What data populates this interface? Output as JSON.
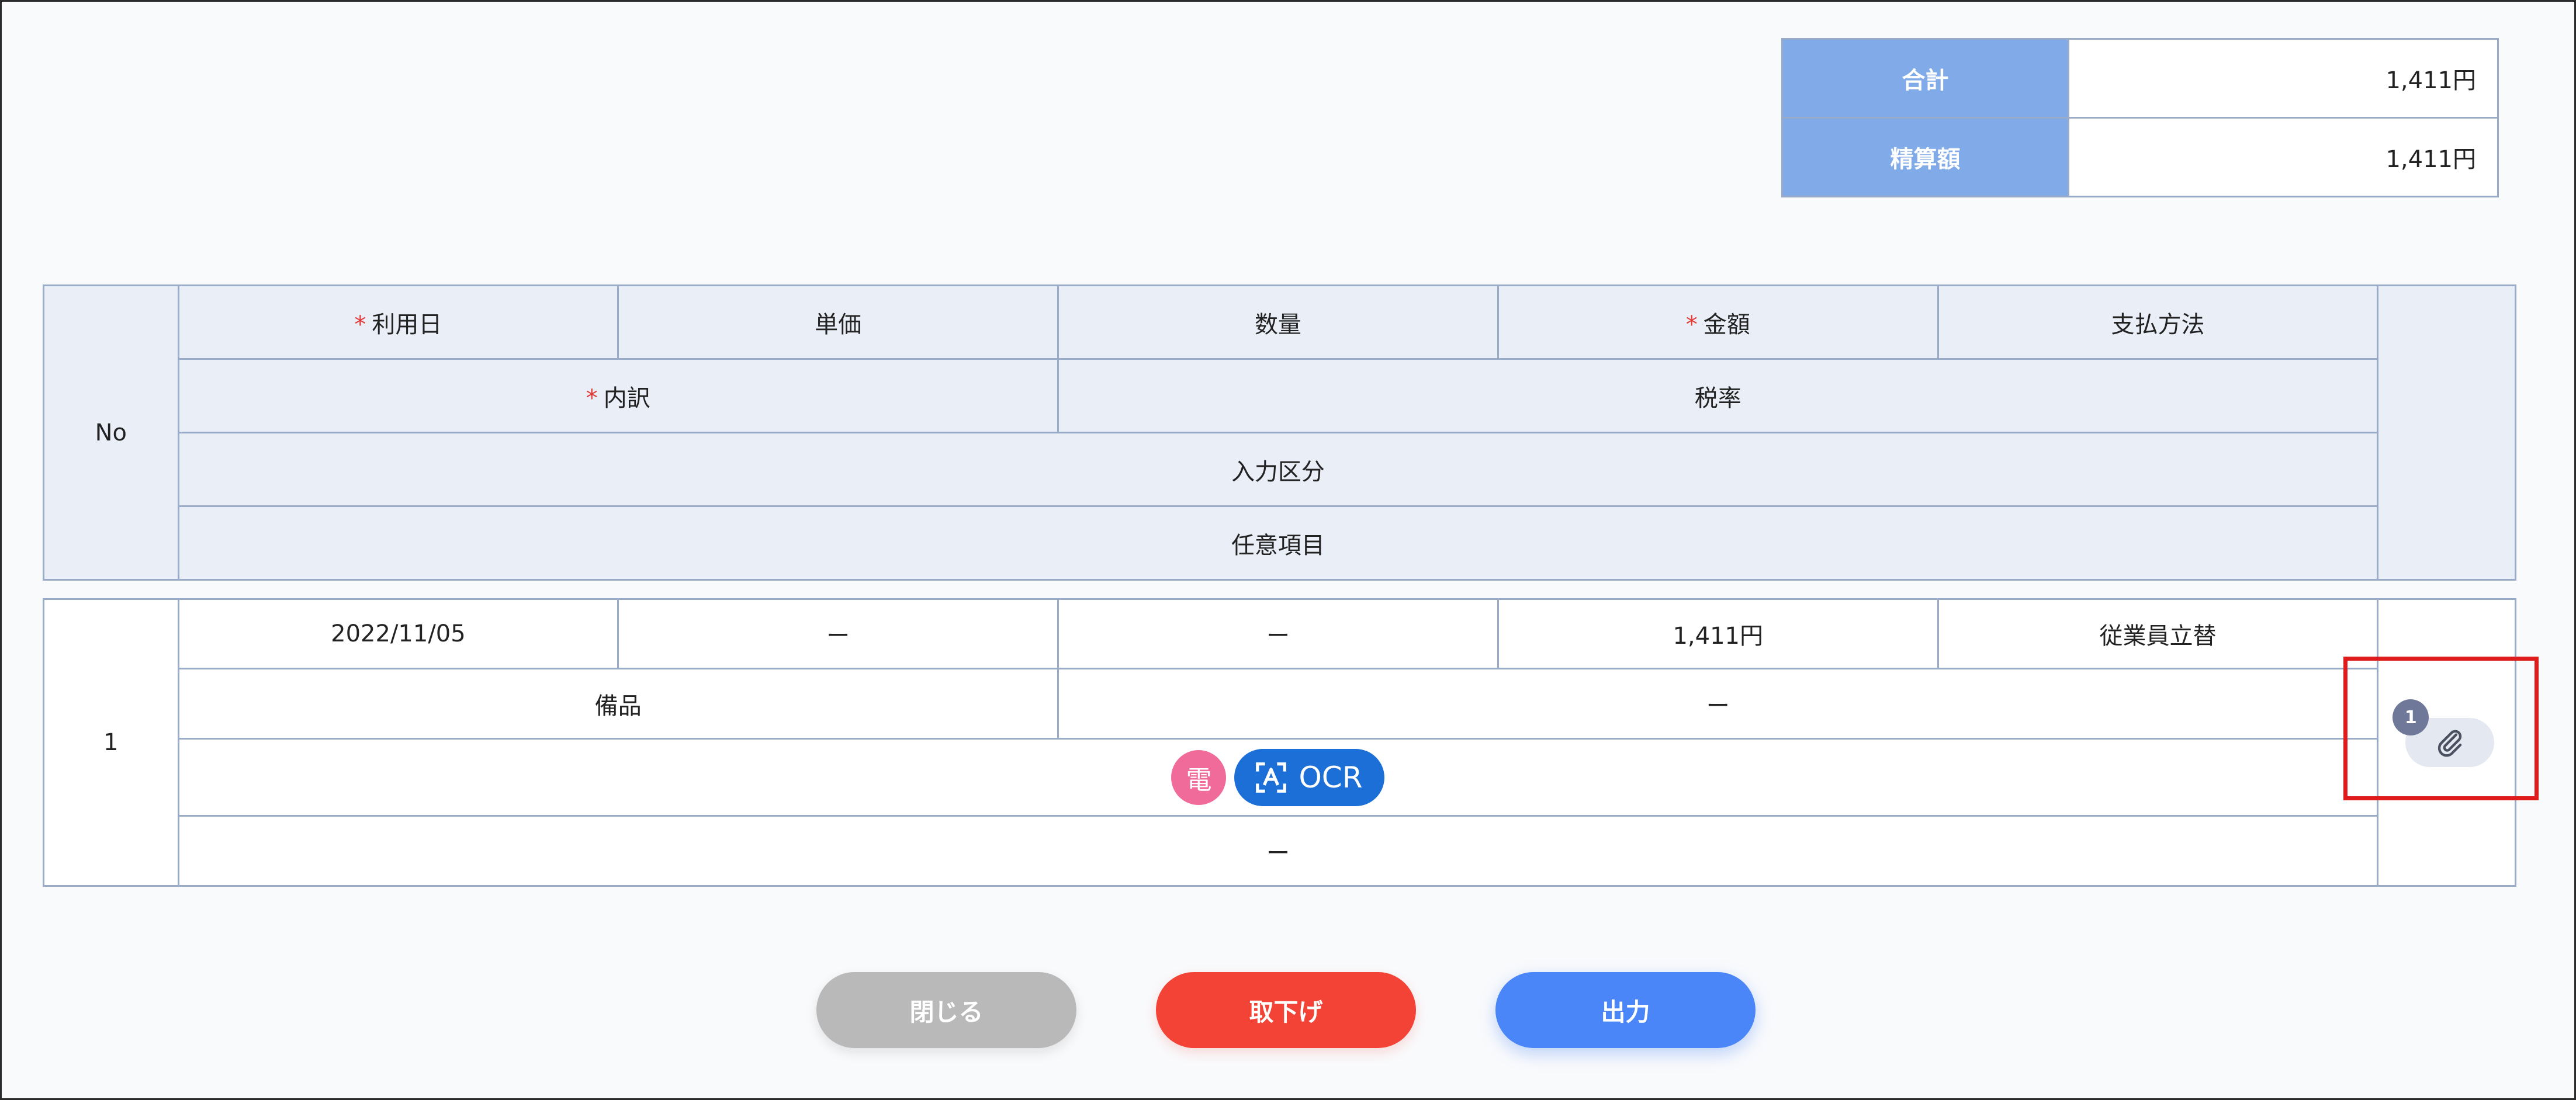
{
  "summary": {
    "rows": [
      {
        "label": "合計",
        "value": "1,411円"
      },
      {
        "label": "精算額",
        "value": "1,411円"
      }
    ]
  },
  "header": {
    "no": "No",
    "usage_date": "利用日",
    "unit_price": "単価",
    "quantity": "数量",
    "amount": "金額",
    "payment_method": "支払方法",
    "breakdown": "内訳",
    "tax_rate": "税率",
    "input_category": "入力区分",
    "optional_item": "任意項目",
    "required_mark": "*"
  },
  "rows": [
    {
      "no": "1",
      "usage_date": "2022/11/05",
      "unit_price": "ー",
      "quantity": "ー",
      "amount": "1,411円",
      "payment_method": "従業員立替",
      "breakdown": "備品",
      "tax_rate": "ー",
      "input_badges": {
        "electronic": "電",
        "ocr": "OCR"
      },
      "optional_item": "ー",
      "attachment_count": "1"
    }
  ],
  "buttons": {
    "close": "閉じる",
    "withdraw": "取下げ",
    "output": "出力"
  },
  "icons": {
    "attachment": "paperclip-icon",
    "ocr": "text-scan-icon"
  },
  "colors": {
    "summary_label_bg": "#80aae8",
    "header_bg": "#e9eef7",
    "border": "#9aabc7",
    "required": "#e53935",
    "electronic_badge": "#f06b9a",
    "ocr_badge": "#1c6fd6",
    "close_button": "#b9b9b9",
    "withdraw_button": "#f34336",
    "output_button": "#4a86f7",
    "highlight": "#e01b1b"
  }
}
